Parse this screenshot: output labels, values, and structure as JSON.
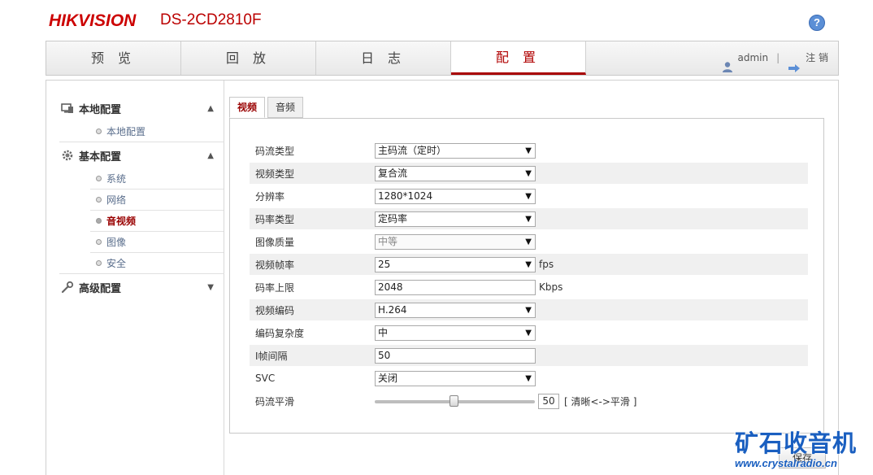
{
  "header": {
    "brand": "HIKVISION",
    "model": "DS-2CD2810F",
    "help_label": "?"
  },
  "nav": {
    "tabs": [
      {
        "label": "预 览"
      },
      {
        "label": "回 放"
      },
      {
        "label": "日 志"
      },
      {
        "label": "配 置"
      }
    ],
    "active_tab": "配 置",
    "user": "admin",
    "separator": "|",
    "logout": "注 销"
  },
  "sidebar": {
    "sections": [
      {
        "label": "本地配置",
        "icon": "monitor-icon",
        "expanded": true,
        "items": [
          "本地配置"
        ]
      },
      {
        "label": "基本配置",
        "icon": "gear-icon",
        "expanded": true,
        "items": [
          "系统",
          "网络",
          "音视频",
          "图像",
          "安全"
        ]
      },
      {
        "label": "高级配置",
        "icon": "wrench-icon",
        "expanded": false,
        "items": []
      }
    ],
    "active_item": "音视频"
  },
  "subtabs": {
    "video": "视频",
    "audio": "音频",
    "active": "视频"
  },
  "form": {
    "stream_type": {
      "label": "码流类型",
      "value": "主码流（定时）"
    },
    "video_type": {
      "label": "视频类型",
      "value": "复合流"
    },
    "resolution": {
      "label": "分辨率",
      "value": "1280*1024"
    },
    "bitrate_type": {
      "label": "码率类型",
      "value": "定码率"
    },
    "image_quality": {
      "label": "图像质量",
      "value": "中等",
      "disabled": true
    },
    "frame_rate": {
      "label": "视频帧率",
      "value": "25",
      "unit": "fps"
    },
    "max_bitrate": {
      "label": "码率上限",
      "value": "2048",
      "unit": "Kbps"
    },
    "video_encoding": {
      "label": "视频编码",
      "value": "H.264"
    },
    "encoding_complexity": {
      "label": "编码复杂度",
      "value": "中"
    },
    "i_frame_interval": {
      "label": "I帧间隔",
      "value": "50"
    },
    "svc": {
      "label": "SVC",
      "value": "关闭"
    },
    "stream_smoothing": {
      "label": "码流平滑",
      "value": "50",
      "min": 1,
      "max": 100,
      "note": "[ 清晰<->平滑 ]"
    }
  },
  "save_label": "保存",
  "watermark": {
    "text": "矿石收音机",
    "url": "www.crystalradio.cn"
  },
  "colors": {
    "brand_red": "#c00000",
    "active_red": "#a80000",
    "link_blue": "#5a6e8c",
    "watermark_blue": "#1a5fc0"
  }
}
